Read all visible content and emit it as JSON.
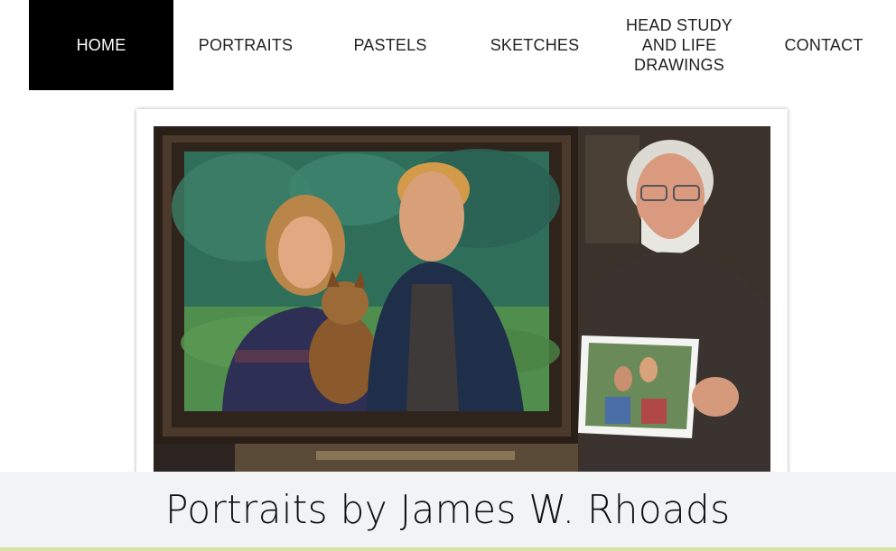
{
  "nav": {
    "items": [
      {
        "label": "HOME",
        "active": true
      },
      {
        "label": "PORTRAITS",
        "active": false
      },
      {
        "label": "PASTELS",
        "active": false
      },
      {
        "label": "SKETCHES",
        "active": false
      },
      {
        "label": "HEAD STUDY AND LIFE DRAWINGS",
        "active": false
      },
      {
        "label": "CONTACT",
        "active": false
      }
    ]
  },
  "hero": {
    "image": "photo of artist holding reference photo beside framed couple-with-dog portrait"
  },
  "site": {
    "title": "Portraits by James W. Rhoads"
  },
  "colors": {
    "nav_active_bg": "#000000",
    "title_band_bg": "#f2f3f5",
    "bottom_accent": "#d6e3a3"
  }
}
